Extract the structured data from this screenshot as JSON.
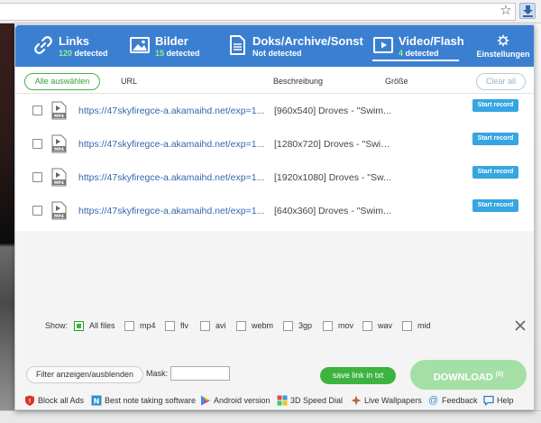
{
  "browser": {
    "star_icon": "star-icon",
    "extension_icon": "download-extension-icon"
  },
  "header": {
    "tabs": [
      {
        "label": "Links",
        "count": "120",
        "suffix": "detected",
        "icon": "link-icon"
      },
      {
        "label": "Bilder",
        "count": "15",
        "suffix": "detected",
        "icon": "image-icon"
      },
      {
        "label": "Doks/Archive/Sonst",
        "status": "Not detected",
        "icon": "document-icon"
      },
      {
        "label": "Video/Flash",
        "count": "4",
        "suffix": "detected",
        "icon": "video-icon",
        "active": true
      }
    ],
    "settings_label": "Einstellungen"
  },
  "columns": {
    "select_all": "Alle auswählen",
    "url": "URL",
    "description": "Beschreibung",
    "size": "Größe",
    "clear_all": "Clear all"
  },
  "rows": [
    {
      "url": "https://47skyfiregce-a.akamaihd.net/exp=1...",
      "description": "[960x540] Droves - \"Swim...",
      "action": "Start record",
      "file_type": "MP4"
    },
    {
      "url": "https://47skyfiregce-a.akamaihd.net/exp=1...",
      "description": "[1280x720] Droves - \"Swim...",
      "action": "Start record",
      "file_type": "MP4"
    },
    {
      "url": "https://47skyfiregce-a.akamaihd.net/exp=1...",
      "description": "[1920x1080] Droves - \"Sw...",
      "action": "Start record",
      "file_type": "MP4"
    },
    {
      "url": "https://47skyfiregce-a.akamaihd.net/exp=1...",
      "description": "[640x360] Droves - \"Swim...",
      "action": "Start record",
      "file_type": "MP4"
    }
  ],
  "filters": {
    "show_label": "Show:",
    "items": [
      {
        "label": "All files",
        "checked": true
      },
      {
        "label": "mp4",
        "checked": false
      },
      {
        "label": "flv",
        "checked": false
      },
      {
        "label": "avi",
        "checked": false
      },
      {
        "label": "webm",
        "checked": false
      },
      {
        "label": "3gp",
        "checked": false
      },
      {
        "label": "mov",
        "checked": false
      },
      {
        "label": "wav",
        "checked": false
      },
      {
        "label": "mid",
        "checked": false
      }
    ]
  },
  "controls": {
    "filter_toggle": "Filter anzeigen/ausblenden",
    "mask_label": "Mask:",
    "mask_value": "",
    "save_link": "save link in txt",
    "download_label": "DOWNLOAD",
    "download_count": "(0)"
  },
  "footer": [
    {
      "label": "Block all Ads",
      "icon": "shield-icon"
    },
    {
      "label": "Best note taking software",
      "icon": "note-icon"
    },
    {
      "label": "Android version",
      "icon": "play-store-icon"
    },
    {
      "label": "3D Speed Dial",
      "icon": "speed-dial-icon"
    },
    {
      "label": "Live Wallpapers",
      "icon": "wallpaper-icon"
    },
    {
      "label": "Feedback",
      "icon": "feedback-icon"
    },
    {
      "label": "Help",
      "icon": "help-icon"
    }
  ],
  "colors": {
    "header_blue": "#3b7fd1",
    "accent_green": "#3cb43f",
    "record_blue": "#36a5e1",
    "link_blue": "#3565b0"
  }
}
